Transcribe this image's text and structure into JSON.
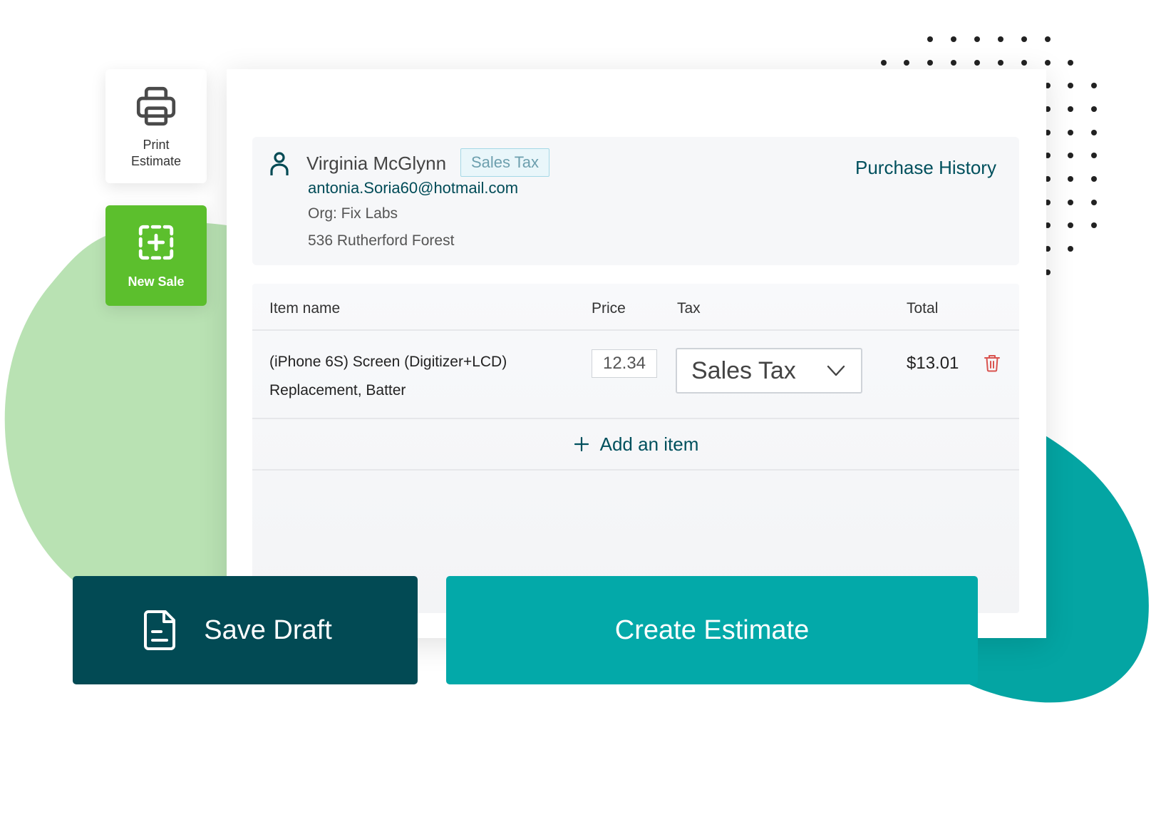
{
  "side_tools": {
    "print_label_1": "Print",
    "print_label_2": "Estimate",
    "new_sale_label": "New Sale"
  },
  "customer": {
    "name": "Virginia McGlynn",
    "tax_badge": "Sales Tax",
    "email": "antonia.Soria60@hotmail.com",
    "org": "Org: Fix Labs",
    "address": "536 Rutherford Forest",
    "purchase_history_link": "Purchase History"
  },
  "table": {
    "columns": [
      "Item name",
      "Price",
      "Tax",
      "Total"
    ],
    "rows": [
      {
        "name_line_1": "(iPhone 6S) Screen (Digitizer+LCD)",
        "name_line_2": "Replacement, Batter",
        "price": "12.34",
        "tax": "Sales Tax",
        "total": "$13.01"
      }
    ],
    "add_item_label": "Add an item"
  },
  "actions": {
    "save_draft": "Save Draft",
    "create_estimate": "Create Estimate"
  },
  "icons": {
    "print": "printer-icon",
    "new_sale": "add-dashed-square-icon",
    "customer": "person-icon",
    "dropdown": "chevron-down-icon",
    "delete": "trash-icon",
    "add": "plus-icon",
    "draft": "document-icon"
  },
  "colors": {
    "primary_dark": "#024a54",
    "primary_teal": "#03a9a9",
    "green": "#5cbf2d",
    "link": "#00505d",
    "delete_red": "#d9534f"
  }
}
